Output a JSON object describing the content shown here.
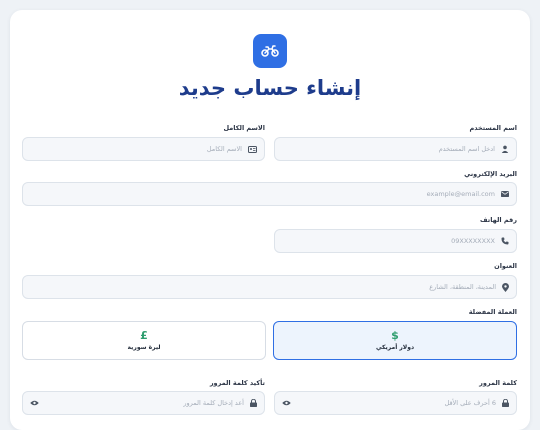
{
  "title": "إنشاء حساب جديد",
  "fields": {
    "username": {
      "label": "اسم المستخدم",
      "placeholder": "ادخل اسم المستخدم"
    },
    "fullname": {
      "label": "الاسم الكامل",
      "placeholder": "الاسم الكامل"
    },
    "email": {
      "label": "البريد الإلكتروني",
      "placeholder": "example@email.com"
    },
    "phone": {
      "label": "رقم الهاتف",
      "placeholder": "09XXXXXXXX"
    },
    "address": {
      "label": "العنوان",
      "placeholder": "المدينة، المنطقة، الشارع"
    },
    "password": {
      "label": "كلمة المرور",
      "placeholder": "6 أحرف على الأقل"
    },
    "confirm": {
      "label": "تأكيد كلمة المرور",
      "placeholder": "أعد إدخال كلمة المرور"
    }
  },
  "currency": {
    "label": "العملة المفضلة",
    "options": [
      {
        "symbol": "$",
        "name": "دولار أمريكي",
        "selected": true
      },
      {
        "symbol": "£",
        "name": "ليرة سورية",
        "selected": false
      }
    ]
  },
  "colors": {
    "accent": "#2f6fe4",
    "title": "#1e3c8c",
    "currency_symbol": "#2f9e6f"
  }
}
